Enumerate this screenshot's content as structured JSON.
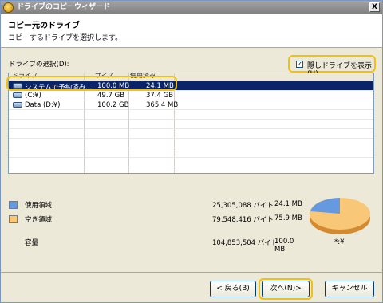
{
  "window": {
    "title": "ドライブのコピーウィザード",
    "close_label": "X"
  },
  "header": {
    "title": "コピー元のドライブ",
    "subtitle": "コピーするドライブを選択します。"
  },
  "drive_select_label": "ドライブの選択(D):",
  "show_hidden": {
    "label": "隠しドライブを表示(H)",
    "checked": true
  },
  "table": {
    "columns": [
      "ドライブ",
      "サイズ",
      "使用済み"
    ],
    "rows": [
      {
        "name": "システムで予約済み...",
        "size": "100.0 MB",
        "used": "24.1 MB",
        "selected": true
      },
      {
        "name": "(C:¥)",
        "size": "49.7 GB",
        "used": "37.4 GB",
        "selected": false
      },
      {
        "name": "Data (D:¥)",
        "size": "100.2 GB",
        "used": "365.4 MB",
        "selected": false
      }
    ]
  },
  "legend": {
    "used": {
      "label": "使用領域",
      "bytes": "25,305,088 バイト",
      "size": "24.1 MB",
      "color": "#6699e0"
    },
    "free": {
      "label": "空き領域",
      "bytes": "79,548,416 バイト",
      "size": "75.9 MB",
      "color": "#f8c878"
    },
    "capacity": {
      "label": "容量",
      "bytes": "104,853,504 バイト",
      "size": "100.0 MB"
    },
    "drive_letter": "*:¥"
  },
  "buttons": {
    "back": "< 戻る(B)",
    "next": "次へ(N)>",
    "cancel": "キャンセル"
  }
}
